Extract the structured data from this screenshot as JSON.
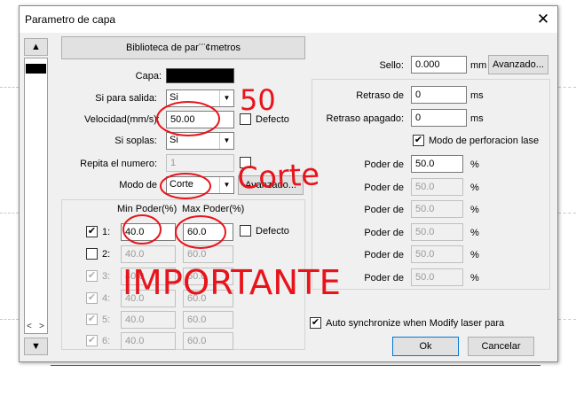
{
  "dialog": {
    "title": "Parametro de capa",
    "close_glyph": "✕"
  },
  "sidebar": {
    "up_glyph": "▲",
    "down_glyph": "▼",
    "scroll_left": "<",
    "scroll_right": ">"
  },
  "left": {
    "library_button": "Biblioteca de par¨¨¢metros",
    "capa_label": "Capa:",
    "capa_color": "#000000",
    "output_label": "Si para salida:",
    "output_value": "Si",
    "speed_label": "Velocidad(mm/s):",
    "speed_value": "50.00",
    "speed_default_label": "Defecto",
    "blow_label": "Si soplas:",
    "blow_value": "Si",
    "repeat_label": "Repita el numero:",
    "repeat_value": "1",
    "mode_label": "Modo de",
    "mode_value": "Corte",
    "advanced_button": "Avanzado...",
    "min_power_header": "Min Poder(%)",
    "max_power_header": "Max Poder(%)",
    "power_default_label": "Defecto",
    "power_rows": [
      {
        "label": "1:",
        "checked": "✔",
        "min": "40.0",
        "max": "60.0"
      },
      {
        "label": "2:",
        "checked": "",
        "min": "40.0",
        "max": "60.0"
      },
      {
        "label": "3:",
        "checked": "✔",
        "min": "40.0",
        "max": "60.0"
      },
      {
        "label": "4:",
        "checked": "✔",
        "min": "40.0",
        "max": "60.0"
      },
      {
        "label": "5:",
        "checked": "✔",
        "min": "40.0",
        "max": "60.0"
      },
      {
        "label": "6:",
        "checked": "✔",
        "min": "40.0",
        "max": "60.0"
      }
    ]
  },
  "right": {
    "seal_label": "Sello:",
    "seal_value": "0.000",
    "seal_unit": "mm",
    "advanced_button": "Avanzado...",
    "delay_on_label": "Retraso de",
    "delay_on_value": "0",
    "delay_off_label": "Retraso apagado:",
    "delay_off_value": "0",
    "ms_unit": "ms",
    "perf_mode_label": "Modo de perforacion lase",
    "perf_mode_checked": "✔",
    "power_label": "Poder de",
    "percent_unit": "%",
    "power_values": [
      "50.0",
      "50.0",
      "50.0",
      "50.0",
      "50.0",
      "50.0"
    ]
  },
  "bottom": {
    "auto_sync_label": "Auto synchronize when Modify laser para",
    "auto_sync_checked": "✔",
    "ok_button": "Ok",
    "cancel_button": "Cancelar"
  },
  "annotations": {
    "color": "#e8141b",
    "text_50": "50",
    "text_corte": "Corte",
    "text_importante": "IMPORTANTE"
  }
}
